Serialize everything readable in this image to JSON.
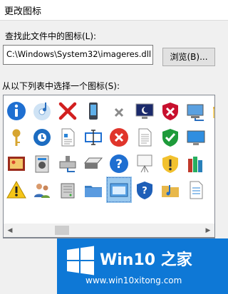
{
  "window": {
    "title": "更改图标"
  },
  "labels": {
    "look_for": "查找此文件中的图标(L):",
    "select_from": "从以下列表中选择一个图标(S):"
  },
  "path_field": {
    "value": "C:\\Windows\\System32\\imageres.dll"
  },
  "buttons": {
    "browse": "浏览(B)..."
  },
  "icons": {
    "selected_index": 31,
    "names": [
      "info-icon",
      "music-disc-icon",
      "red-x-icon",
      "mobile-device-icon",
      "small-x-icon",
      "monitor-moon-icon",
      "shield-x-icon",
      "network-computer-icon",
      "folder-icon",
      "key-icon",
      "clock-disc-icon",
      "document-rich-icon",
      "text-cursor-icon",
      "red-x-circle-icon",
      "document-lines-icon",
      "shield-check-icon",
      "monitor-blue-icon",
      "folder-partial-icon",
      "photo-album-icon",
      "media-box-icon",
      "drive-network-icon",
      "scanner-icon",
      "help-icon",
      "projector-icon",
      "shield-warning-icon",
      "library-books-icon",
      "folder-partial-2-icon",
      "warning-icon",
      "users-icon",
      "server-icon",
      "blue-folder-icon",
      "window-selected-icon",
      "shield-help-icon",
      "music-folder-icon",
      "document-list-icon",
      "folder-partial-3-icon"
    ]
  },
  "watermark": {
    "brand": "Win10 之家",
    "url": "www.win10xitong.com"
  },
  "colors": {
    "accent": "#0e78d6",
    "selection": "#99c9ef"
  }
}
